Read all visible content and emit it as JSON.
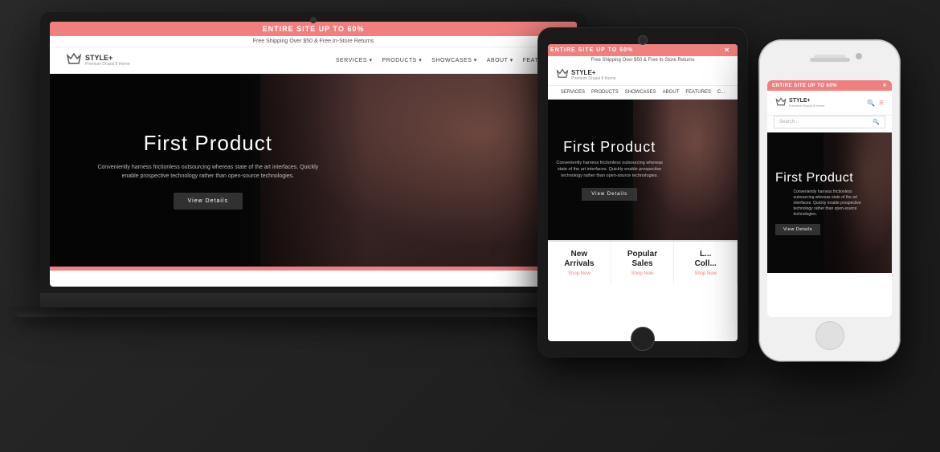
{
  "scene": {
    "background": "#1a1a1a"
  },
  "website": {
    "banner": "ENTIRE SITE UP TO 60%",
    "subbar": "Free Shipping Over $50 & Free In-Store Returns",
    "logo": {
      "name": "STYLE+",
      "tagline": "Premium Drupal 8 theme"
    },
    "nav": {
      "links": [
        "SERVICES",
        "PRODUCTS",
        "SHOWCASES",
        "ABOUT",
        "FEATURES"
      ]
    },
    "hero": {
      "title": "First Product",
      "description": "Conveniently harness frictionless outsourcing whereas state of the art interfaces. Quickly enable prospective technology rather than open-source technologies.",
      "button": "View Details"
    },
    "categories": [
      {
        "title": "New Arrivals",
        "link": "Shop Now"
      },
      {
        "title": "Popular Sales",
        "link": "Shop Now"
      },
      {
        "title": "Latest Coll...",
        "link": "Shop Now"
      }
    ],
    "close_icon": "✕",
    "search_placeholder": "Search...",
    "menu_icon": "≡",
    "search_icon": "🔍"
  }
}
